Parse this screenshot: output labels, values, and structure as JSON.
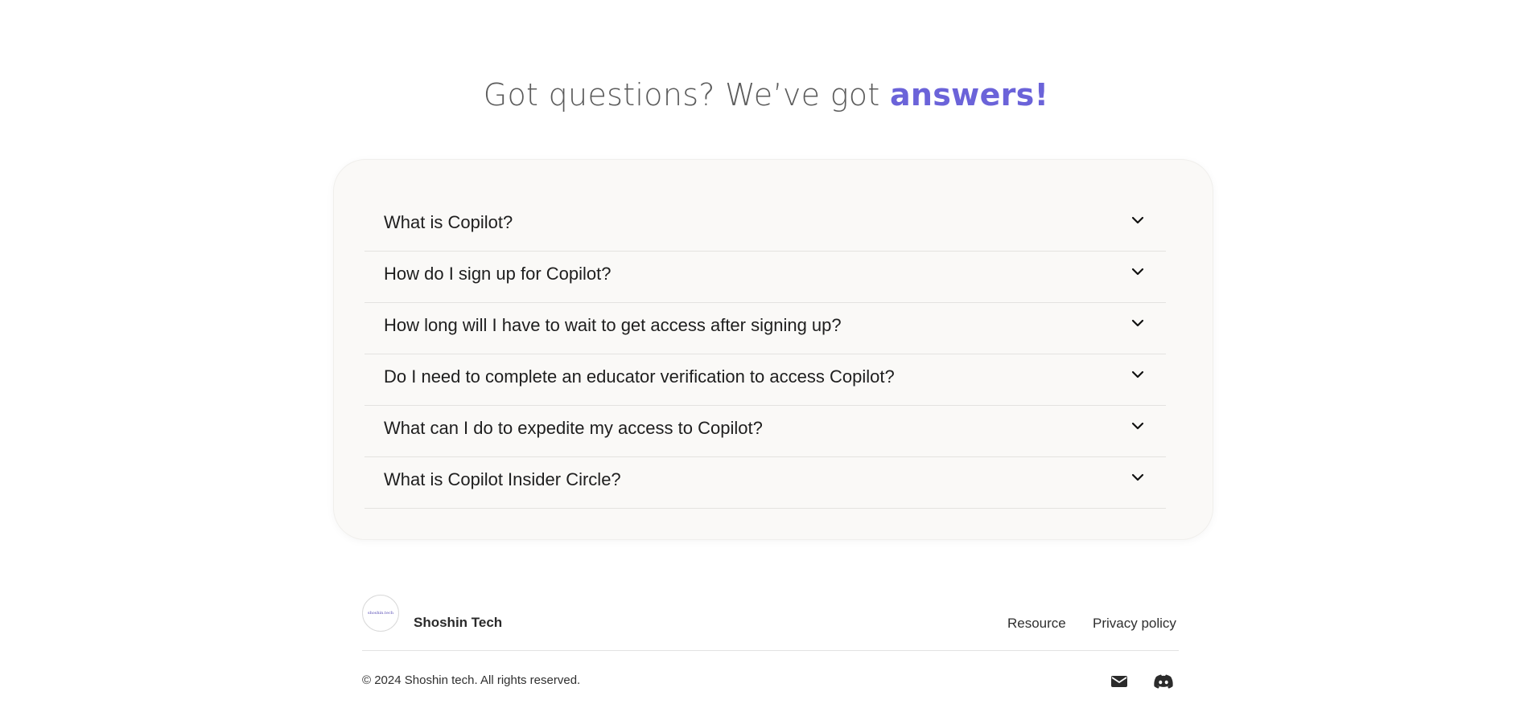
{
  "faq_section": {
    "heading_prefix": "Got questions? We’ve got ",
    "heading_accent": "answers!",
    "accent_color": "#6b63d9",
    "items": [
      {
        "question": "What is Copilot?",
        "icon": "chevron-down-icon"
      },
      {
        "question": "How do I sign up for Copilot?",
        "icon": "chevron-down-icon"
      },
      {
        "question": "How long will I have to wait to get access after signing up?",
        "icon": "chevron-down-icon"
      },
      {
        "question": "Do I need to complete an educator verification to access Copilot?",
        "icon": "chevron-down-icon"
      },
      {
        "question": "What can I do to expedite my access to Copilot?",
        "icon": "chevron-down-icon"
      },
      {
        "question": "What is Copilot Insider Circle?",
        "icon": "chevron-down-icon"
      }
    ]
  },
  "footer": {
    "logo_text": "shoshin.tech",
    "brand_name": "Shoshin Tech",
    "links": [
      {
        "label": "Resource"
      },
      {
        "label": "Privacy policy"
      }
    ],
    "copyright": "© 2024 Shoshin tech. All rights reserved.",
    "social_icons": [
      "mail-icon",
      "discord-icon"
    ]
  }
}
